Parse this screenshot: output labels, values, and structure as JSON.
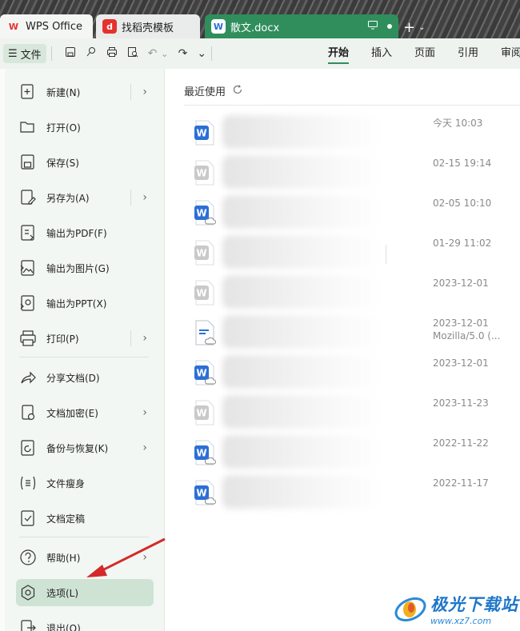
{
  "tabs": {
    "wps": "WPS Office",
    "find": "找稻壳模板",
    "doc": "散文.docx"
  },
  "toolbar": {
    "file_label": "文件",
    "menu": [
      "开始",
      "插入",
      "页面",
      "引用",
      "审阅"
    ]
  },
  "file_menu": {
    "items": [
      {
        "label": "新建(N)",
        "icon": "new-file-icon",
        "submenu": true
      },
      {
        "label": "打开(O)",
        "icon": "folder-open-icon",
        "submenu": false
      },
      {
        "label": "保存(S)",
        "icon": "save-icon",
        "submenu": false
      },
      {
        "label": "另存为(A)",
        "icon": "save-as-icon",
        "submenu": true
      },
      {
        "label": "输出为PDF(F)",
        "icon": "export-pdf-icon",
        "submenu": false
      },
      {
        "label": "输出为图片(G)",
        "icon": "export-image-icon",
        "submenu": false
      },
      {
        "label": "输出为PPT(X)",
        "icon": "export-ppt-icon",
        "submenu": false
      },
      {
        "label": "打印(P)",
        "icon": "printer-icon",
        "submenu": true
      },
      {
        "label": "分享文档(D)",
        "icon": "share-icon",
        "submenu": false
      },
      {
        "label": "文档加密(E)",
        "icon": "lock-icon",
        "submenu": true
      },
      {
        "label": "备份与恢复(K)",
        "icon": "backup-icon",
        "submenu": true
      },
      {
        "label": "文件瘦身",
        "icon": "slim-icon",
        "submenu": false
      },
      {
        "label": "文档定稿",
        "icon": "finalize-icon",
        "submenu": false
      },
      {
        "label": "帮助(H)",
        "icon": "help-icon",
        "submenu": true
      },
      {
        "label": "选项(L)",
        "icon": "settings-icon",
        "submenu": false
      },
      {
        "label": "退出(Q)",
        "icon": "exit-icon",
        "submenu": false
      }
    ]
  },
  "recent": {
    "title": "最近使用",
    "files": [
      {
        "time": "今天 10:03",
        "icon": "word-doc-icon",
        "extra": ""
      },
      {
        "time": "02-15 19:14",
        "icon": "word-doc-gray-icon",
        "extra": ""
      },
      {
        "time": "02-05 10:10",
        "icon": "word-cloud-icon",
        "extra": ""
      },
      {
        "time": "01-29 11:02",
        "icon": "word-doc-gray-icon",
        "extra": ""
      },
      {
        "time": "2023-12-01",
        "icon": "word-doc-gray-icon",
        "extra": ""
      },
      {
        "time": "2023-12-01",
        "icon": "text-cloud-icon",
        "extra": "Mozilla/5.0 (..."
      },
      {
        "time": "2023-12-01",
        "icon": "word-cloud-icon",
        "extra": ""
      },
      {
        "time": "2023-11-23",
        "icon": "word-doc-gray-icon",
        "extra": ""
      },
      {
        "time": "2022-11-22",
        "icon": "word-cloud-icon",
        "extra": ""
      },
      {
        "time": "2022-11-17",
        "icon": "word-cloud-icon",
        "extra": ""
      }
    ]
  },
  "watermark": {
    "main": "极光下载站",
    "url": "www.xz7.com"
  },
  "colors": {
    "accent": "#2f8e5c",
    "word_blue": "#2b6fd6",
    "arrow_red": "#d42a2a"
  }
}
